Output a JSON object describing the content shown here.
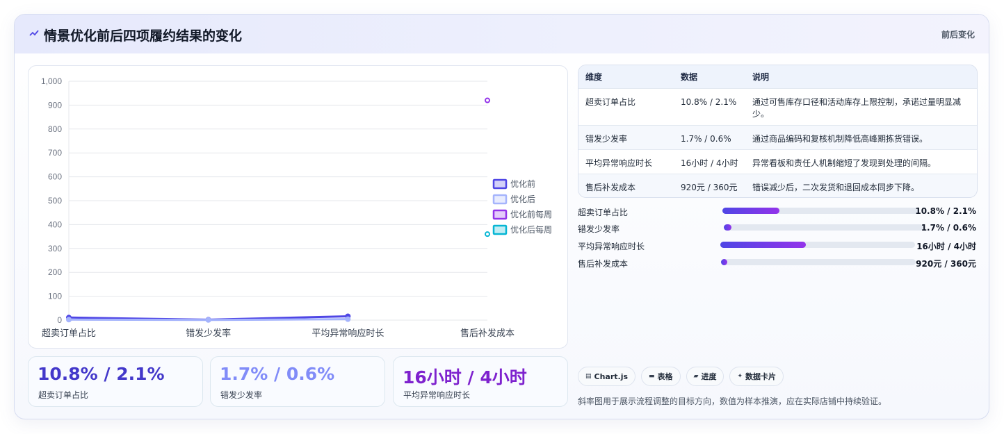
{
  "header": {
    "title": "情景优化前后四项履约结果的变化",
    "tag": "前后变化",
    "accent": "#4f46e5"
  },
  "chart_data": {
    "type": "line",
    "categories": [
      "超卖订单占比",
      "错发少发率",
      "平均异常响应时长",
      "售后补发成本"
    ],
    "ylim": [
      0,
      1000
    ],
    "yticks": [
      "0",
      "100",
      "200",
      "300",
      "400",
      "500",
      "600",
      "700",
      "800",
      "900",
      "1,000"
    ],
    "series": [
      {
        "name": "优化前",
        "values": [
          10.8,
          1.7,
          16,
          null
        ],
        "color": "#4f46e5"
      },
      {
        "name": "优化后",
        "values": [
          2.1,
          0.6,
          4,
          null
        ],
        "color": "#a5b4fc"
      },
      {
        "name": "优化前每周",
        "values": [
          null,
          null,
          null,
          920
        ],
        "color": "#9333ea"
      },
      {
        "name": "优化后每周",
        "values": [
          null,
          null,
          null,
          360
        ],
        "color": "#06b6d4"
      }
    ],
    "legend_position": "right"
  },
  "stats": [
    {
      "value": "10.8% / 2.1%",
      "label": "超卖订单占比",
      "color": "#4338ca"
    },
    {
      "value": "1.7% / 0.6%",
      "label": "错发少发率",
      "color": "#818cf8"
    },
    {
      "value": "16小时 / 4小时",
      "label": "平均异常响应时长",
      "color": "#7e22ce"
    }
  ],
  "table": {
    "headers": [
      "维度",
      "数据",
      "说明"
    ],
    "rows": [
      [
        "超卖订单占比",
        "10.8% / 2.1%",
        "通过可售库存口径和活动库存上限控制，承诺过量明显减少。"
      ],
      [
        "错发少发率",
        "1.7% / 0.6%",
        "通过商品编码和复核机制降低高峰期拣货错误。"
      ],
      [
        "平均异常响应时长",
        "16小时 / 4小时",
        "异常看板和责任人机制缩短了发现到处理的间隔。"
      ],
      [
        "售后补发成本",
        "920元 / 360元",
        "错误减少后，二次发货和退回成本同步下降。"
      ]
    ]
  },
  "progress": [
    {
      "label": "超卖订单占比",
      "value": "10.8% / 2.1%",
      "fraction": 0.29
    },
    {
      "label": "错发少发率",
      "value": "1.7% / 0.6%",
      "fraction": 0.04
    },
    {
      "label": "平均异常响应时长",
      "value": "16小时 / 4小时",
      "fraction": 0.44
    },
    {
      "label": "售后补发成本",
      "value": "920元 / 360元",
      "fraction": 0.03
    }
  ],
  "chips": [
    {
      "icon": "chart-icon",
      "label": "Chart.js"
    },
    {
      "icon": "table-icon",
      "label": "表格"
    },
    {
      "icon": "progress-icon",
      "label": "进度"
    },
    {
      "icon": "card-icon",
      "label": "数据卡片"
    }
  ],
  "note": "斜率图用于展示流程调整的目标方向，数值为样本推演，应在实际店铺中持续验证。"
}
